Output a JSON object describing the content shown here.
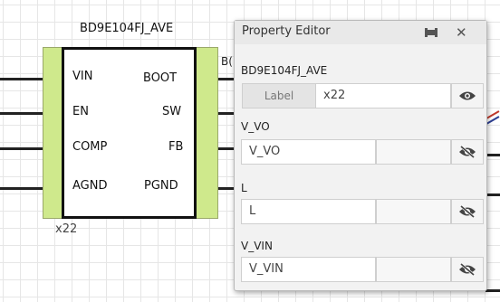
{
  "component": {
    "part_name": "BD9E104FJ_AVE",
    "ref": "x22",
    "net_stub": "B(",
    "left_pins": [
      "VIN",
      "EN",
      "COMP",
      "AGND"
    ],
    "right_pins": [
      "BOOT",
      "SW",
      "FB",
      "PGND"
    ]
  },
  "property_editor": {
    "title": "Property Editor",
    "part_name": "BD9E104FJ_AVE",
    "label_button": "Label",
    "label_value": "x22",
    "fields": [
      {
        "name": "V_VO",
        "value": "V_VO"
      },
      {
        "name": "L",
        "value": "L"
      },
      {
        "name": "V_VIN",
        "value": "V_VIN"
      }
    ]
  },
  "icons": {
    "pin": "pin-icon",
    "close": "close-icon",
    "visibility": "eye-icon",
    "visibility_off": "eye-off-icon"
  },
  "colors": {
    "pin_bar": "#cfe98c",
    "panel_bg": "#f2f2f2",
    "wire": "#222222"
  }
}
